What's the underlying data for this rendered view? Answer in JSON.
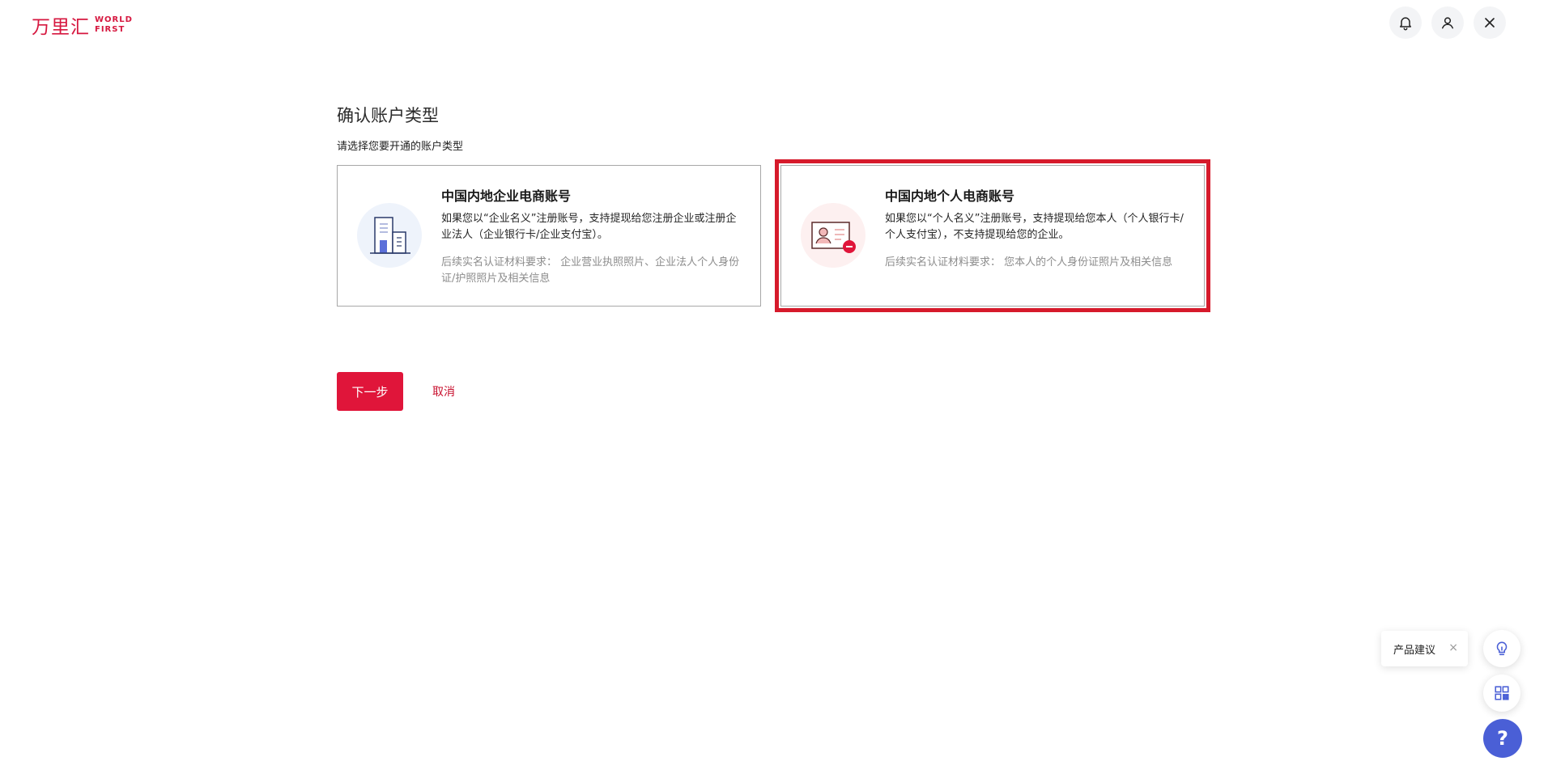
{
  "header": {
    "logo_cn": "万里汇",
    "logo_en_line1": "WORLD",
    "logo_en_line2": "FIRST",
    "icons": [
      "bell-icon",
      "user-icon",
      "close-icon"
    ]
  },
  "main": {
    "title": "确认账户类型",
    "subtitle": "请选择您要开通的账户类型",
    "cards": [
      {
        "title": "中国内地企业电商账号",
        "desc": "如果您以“企业名义”注册账号，支持提现给您注册企业或注册企业法人（企业银行卡/企业支付宝）。",
        "req": "后续实名认证材料要求： 企业营业执照照片、企业法人个人身份证/护照照片及相关信息",
        "icon": "building-icon"
      },
      {
        "title": "中国内地个人电商账号",
        "desc": "如果您以“个人名义”注册账号，支持提现给您本人（个人银行卡/个人支付宝），不支持提现给您的企业。",
        "req": "后续实名认证材料要求： 您本人的个人身份证照片及相关信息",
        "icon": "id-card-icon",
        "selected": true
      }
    ],
    "next_label": "下一步",
    "cancel_label": "取消"
  },
  "floating": {
    "feedback_label": "产品建议",
    "feedback_close": "×",
    "help_label": "?",
    "icons": [
      "lightbulb-icon",
      "qr-code-icon"
    ]
  },
  "colors": {
    "brand": "#d6173f",
    "primary_button": "#e0153a",
    "highlight_border": "#d61a2b",
    "help_button": "#4a5fd6"
  }
}
